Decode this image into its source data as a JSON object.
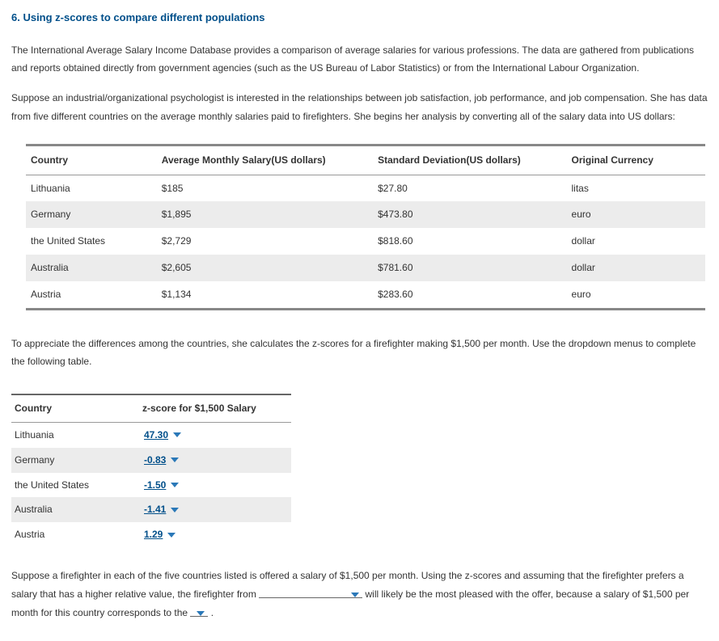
{
  "heading": "6. Using z-scores to compare different populations",
  "para1": "The International Average Salary Income Database provides a comparison of average salaries for various professions. The data are gathered from publications and reports obtained directly from government agencies (such as the US Bureau of Labor Statistics) or from the International Labour Organization.",
  "para2": "Suppose an industrial/organizational psychologist is interested in the relationships between job satisfaction, job performance, and job compensation. She has data from five different countries on the average monthly salaries paid to firefighters. She begins her analysis by converting all of the salary data into US dollars:",
  "table1": {
    "headers": {
      "country": "Country",
      "salary": "Average Monthly Salary(US dollars)",
      "sd": "Standard Deviation(US dollars)",
      "currency": "Original Currency"
    },
    "rows": [
      {
        "country": "Lithuania",
        "salary": "$185",
        "sd": "$27.80",
        "currency": "litas"
      },
      {
        "country": "Germany",
        "salary": "$1,895",
        "sd": "$473.80",
        "currency": "euro"
      },
      {
        "country": "the United States",
        "salary": "$2,729",
        "sd": "$818.60",
        "currency": "dollar"
      },
      {
        "country": "Australia",
        "salary": "$2,605",
        "sd": "$781.60",
        "currency": "dollar"
      },
      {
        "country": "Austria",
        "salary": "$1,134",
        "sd": "$283.60",
        "currency": "euro"
      }
    ]
  },
  "para3": "To appreciate the differences among the countries, she calculates the z-scores for a firefighter making $1,500 per month. Use the dropdown menus to complete the following table.",
  "table2": {
    "headers": {
      "country": "Country",
      "zscore": "z-score for $1,500 Salary"
    },
    "rows": [
      {
        "country": "Lithuania",
        "zscore": "47.30"
      },
      {
        "country": "Germany",
        "zscore": "-0.83"
      },
      {
        "country": "the United States",
        "zscore": "-1.50"
      },
      {
        "country": "Australia",
        "zscore": "-1.41"
      },
      {
        "country": "Austria",
        "zscore": "1.29"
      }
    ]
  },
  "para4": {
    "seg1": "Suppose a firefighter in each of the five countries listed is offered a salary of $1,500 per month. Using the z-scores and assuming that the firefighter prefers a salary that has a higher relative value, the firefighter from ",
    "seg2": " will likely be the most pleased with the offer, because a salary of $1,500 per month for this country corresponds to the ",
    "seg3": " ."
  }
}
